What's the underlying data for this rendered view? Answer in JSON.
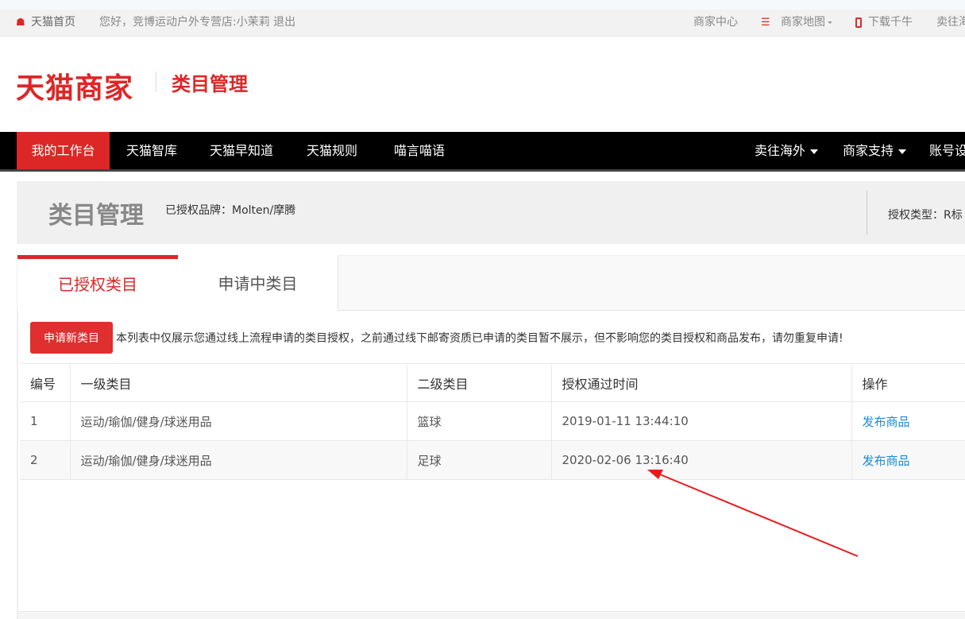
{
  "topbar": {
    "home_label": "天猫首页",
    "greeting": "您好，竞博运动户外专营店:小茉莉 退出",
    "merchant_center": "商家中心",
    "merchant_map": "商家地图",
    "download": "下载千牛",
    "sell_abroad": "卖往海"
  },
  "header": {
    "logo": "天猫商家",
    "title": "类目管理"
  },
  "nav": {
    "items": [
      "我的工作台",
      "天猫智库",
      "天猫早知道",
      "天猫规则",
      "喵言喵语"
    ],
    "right_items": [
      "卖往海外",
      "商家支持",
      "账号设"
    ]
  },
  "panel": {
    "title": "类目管理",
    "brand": "已授权品牌：Molten/摩腾",
    "auth_type": "授权类型：R标"
  },
  "tabs": {
    "authorized": "已授权类目",
    "applying": "申请中类目"
  },
  "content": {
    "apply_button": "申请新类目",
    "notice": "本列表中仅展示您通过线上流程申请的类目授权，之前通过线下邮寄资质已申请的类目暂不展示，但不影响您的类目授权和商品发布，请勿重复申请!"
  },
  "table": {
    "headers": [
      "编号",
      "一级类目",
      "二级类目",
      "授权通过时间",
      "操作"
    ],
    "rows": [
      {
        "num": "1",
        "cat1": "运动/瑜伽/健身/球迷用品",
        "cat2": "篮球",
        "time": "2019-01-11 13:44:10",
        "action": "发布商品"
      },
      {
        "num": "2",
        "cat1": "运动/瑜伽/健身/球迷用品",
        "cat2": "足球",
        "time": "2020-02-06 13:16:40",
        "action": "发布商品"
      }
    ]
  },
  "colors": {
    "brand_red": "#dd2727",
    "link_blue": "#1a8bd6",
    "annotation_arrow": "#e8191c"
  }
}
